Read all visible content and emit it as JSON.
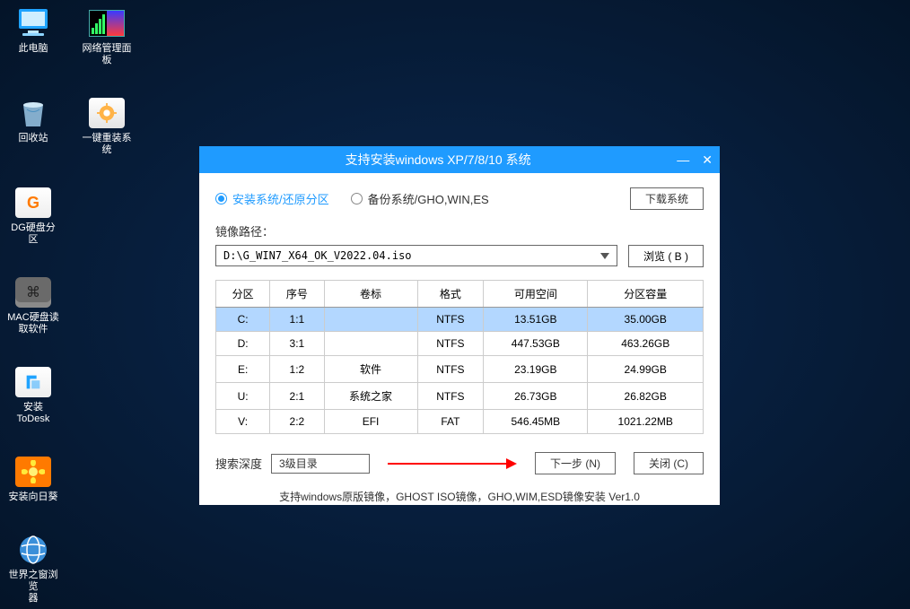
{
  "desktop": {
    "icons": [
      {
        "label": "此电脑"
      },
      {
        "label": "网络管理面板"
      },
      {
        "label": "回收站"
      },
      {
        "label": "一键重装系统"
      },
      {
        "label": "DG硬盘分区"
      },
      {
        "label": "MAC硬盘读\n取软件"
      },
      {
        "label": "安装ToDesk"
      },
      {
        "label": "安装向日葵"
      },
      {
        "label": "世界之窗浏览\n器"
      }
    ]
  },
  "window": {
    "title": "支持安装windows XP/7/8/10 系统",
    "radio1": "安装系统/还原分区",
    "radio2": "备份系统/GHO,WIN,ES",
    "download": "下载系统",
    "image_label": "镜像路径：",
    "image_path": "D:\\G_WIN7_X64_OK_V2022.04.iso",
    "browse": "浏览 ( B )",
    "headers": [
      "分区",
      "序号",
      "卷标",
      "格式",
      "可用空间",
      "分区容量"
    ],
    "rows": [
      {
        "p": "C:",
        "i": "1:1",
        "v": "",
        "f": "NTFS",
        "free": "13.51GB",
        "cap": "35.00GB",
        "sel": true
      },
      {
        "p": "D:",
        "i": "3:1",
        "v": "",
        "f": "NTFS",
        "free": "447.53GB",
        "cap": "463.26GB"
      },
      {
        "p": "E:",
        "i": "1:2",
        "v": "软件",
        "f": "NTFS",
        "free": "23.19GB",
        "cap": "24.99GB"
      },
      {
        "p": "U:",
        "i": "2:1",
        "v": "系统之家",
        "f": "NTFS",
        "free": "26.73GB",
        "cap": "26.82GB"
      },
      {
        "p": "V:",
        "i": "2:2",
        "v": "EFI",
        "f": "FAT",
        "free": "546.45MB",
        "cap": "1021.22MB"
      }
    ],
    "depth_label": "搜索深度",
    "depth_value": "3级目录",
    "next": "下一步 (N)",
    "close": "关闭 (C)",
    "footer": "支持windows原版镜像，GHOST ISO镜像，GHO,WIM,ESD镜像安装 Ver1.0"
  }
}
